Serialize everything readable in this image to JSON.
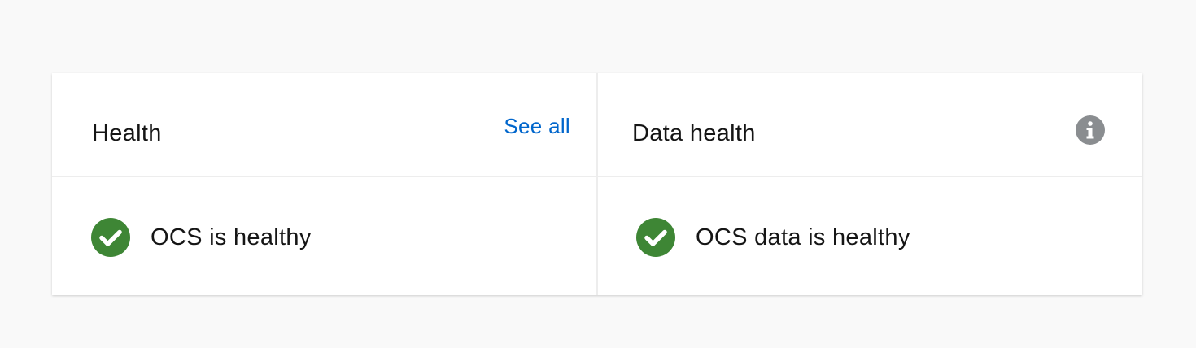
{
  "colors": {
    "background": "#f9f9f9",
    "card": "#ffffff",
    "link": "#0066cc",
    "success": "#3e8635",
    "info_icon": "#8a8d90",
    "divider": "#ededed"
  },
  "health": {
    "title": "Health",
    "see_all_label": "See all",
    "status_icon": "check-circle-icon",
    "status_text": "OCS is healthy"
  },
  "data_health": {
    "title": "Data health",
    "info_icon": "info-circle-icon",
    "status_icon": "check-circle-icon",
    "status_text": "OCS data is healthy"
  }
}
